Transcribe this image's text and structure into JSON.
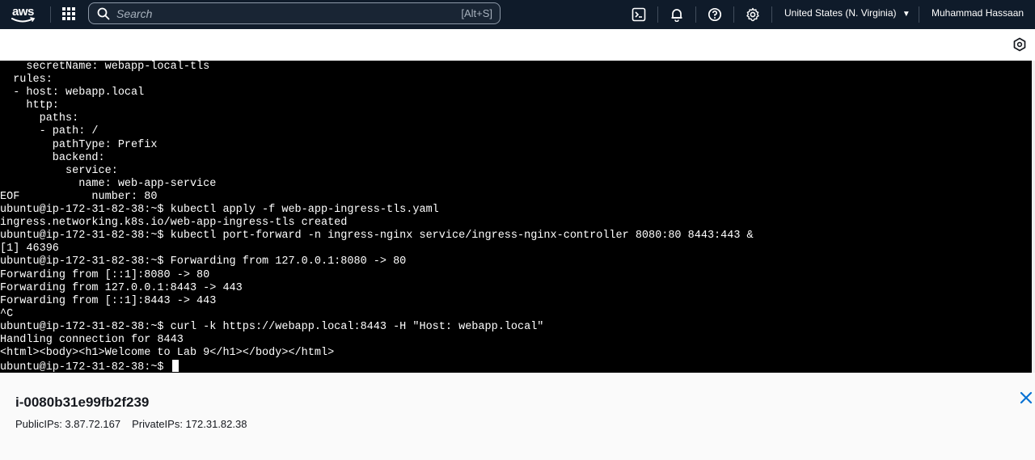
{
  "nav": {
    "logo_text": "aws",
    "search_placeholder": "Search",
    "search_shortcut": "[Alt+S]",
    "region": "United States (N. Virginia)",
    "user": "Muhammad Hassaan"
  },
  "terminal": {
    "lines": [
      "    secretName: webapp-local-tls",
      "  rules:",
      "  - host: webapp.local",
      "    http:",
      "      paths:",
      "      - path: /",
      "        pathType: Prefix",
      "        backend:",
      "          service:",
      "            name: web-app-service",
      "EOF           number: 80",
      "ubuntu@ip-172-31-82-38:~$ kubectl apply -f web-app-ingress-tls.yaml",
      "ingress.networking.k8s.io/web-app-ingress-tls created",
      "ubuntu@ip-172-31-82-38:~$ kubectl port-forward -n ingress-nginx service/ingress-nginx-controller 8080:80 8443:443 &",
      "[1] 46396",
      "ubuntu@ip-172-31-82-38:~$ Forwarding from 127.0.0.1:8080 -> 80",
      "Forwarding from [::1]:8080 -> 80",
      "Forwarding from 127.0.0.1:8443 -> 443",
      "Forwarding from [::1]:8443 -> 443",
      "^C",
      "ubuntu@ip-172-31-82-38:~$ curl -k https://webapp.local:8443 -H \"Host: webapp.local\"",
      "Handling connection for 8443",
      "<html><body><h1>Welcome to Lab 9</h1></body></html>"
    ],
    "prompt": "ubuntu@ip-172-31-82-38:~$ "
  },
  "instance": {
    "id": "i-0080b31e99fb2f239",
    "public_ips": "PublicIPs: 3.87.72.167",
    "private_ips": "PrivateIPs: 172.31.82.38"
  },
  "colors": {
    "nav_bg": "#0f1b2a",
    "terminal_bg": "#000000",
    "terminal_fg": "#ffffff",
    "close_blue": "#0972d3"
  }
}
